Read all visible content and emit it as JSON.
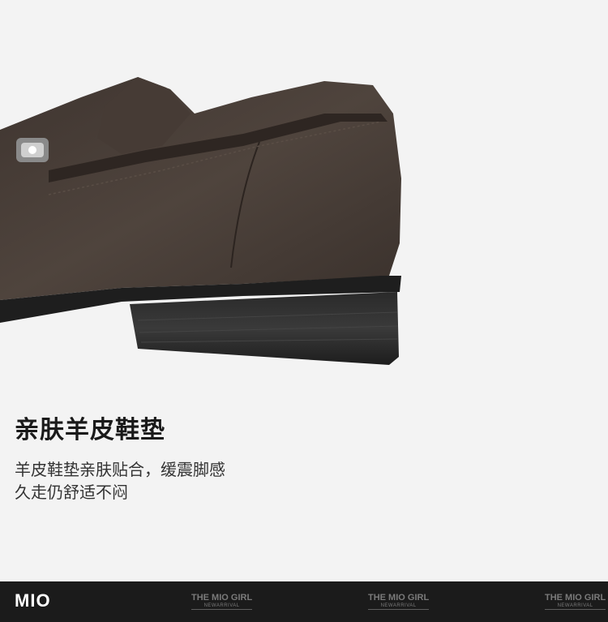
{
  "headline": "亲肤羊皮鞋垫",
  "description": {
    "line1": "羊皮鞋垫亲肤贴合，缓震脚感",
    "line2": "久走仍舒适不闷"
  },
  "footer": {
    "logo": "MIO",
    "watermarks": [
      {
        "title": "THE MIO GIRL",
        "subtitle": "NEWARRIVAL"
      },
      {
        "title": "THE MIO GIRL",
        "subtitle": "NEWARRIVAL"
      },
      {
        "title": "THE MIO GIRL",
        "subtitle": "NEWARRIVAL"
      }
    ]
  },
  "colors": {
    "background": "#f3f3f3",
    "suede": "#4a3f38",
    "sole": "#1e1e1e",
    "footer": "#1b1b1b"
  }
}
